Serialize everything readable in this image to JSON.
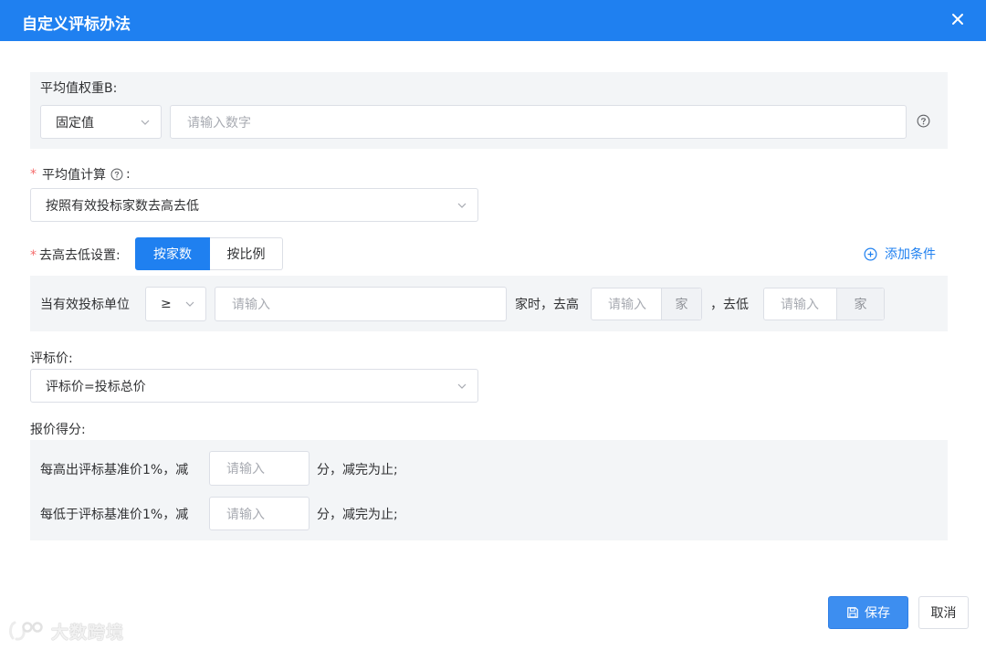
{
  "dialog": {
    "title": "自定义评标办法",
    "close_icon": "close-icon"
  },
  "avg_weight": {
    "label": "平均值权重B:",
    "mode_value": "固定值",
    "input_placeholder": "请输入数字",
    "help_icon": "question-circle-icon"
  },
  "avg_calc": {
    "required_mark": "*",
    "label": "平均值计算",
    "colon": ":",
    "value": "按照有效投标家数去高去低"
  },
  "trim": {
    "required_mark": "*",
    "label": "去高去低设置:",
    "tabs": [
      "按家数",
      "按比例"
    ],
    "active_tab": 0,
    "add_condition": "添加条件",
    "condition": {
      "prefix": "当有效投标单位",
      "operator": "≥",
      "count_placeholder": "请输入",
      "middle": "家时，去高",
      "high_placeholder": "请输入",
      "high_unit": "家",
      "sep": "，去低",
      "low_placeholder": "请输入",
      "low_unit": "家"
    }
  },
  "bid_price": {
    "label": "评标价:",
    "value": "评标价=投标总价"
  },
  "score": {
    "label": "报价得分:",
    "rows": [
      {
        "prefix": "每高出评标基准价1%，减",
        "placeholder": "请输入",
        "suffix": "分，减完为止;"
      },
      {
        "prefix": "每低于评标基准价1%，减",
        "placeholder": "请输入",
        "suffix": "分，减完为止;"
      }
    ]
  },
  "footer": {
    "save_label": "保存",
    "cancel_label": "取消"
  },
  "watermark": {
    "text": "大数跨境"
  },
  "colors": {
    "primary": "#1f80f0",
    "required": "#f56c6c",
    "panel": "#f3f5f7"
  }
}
